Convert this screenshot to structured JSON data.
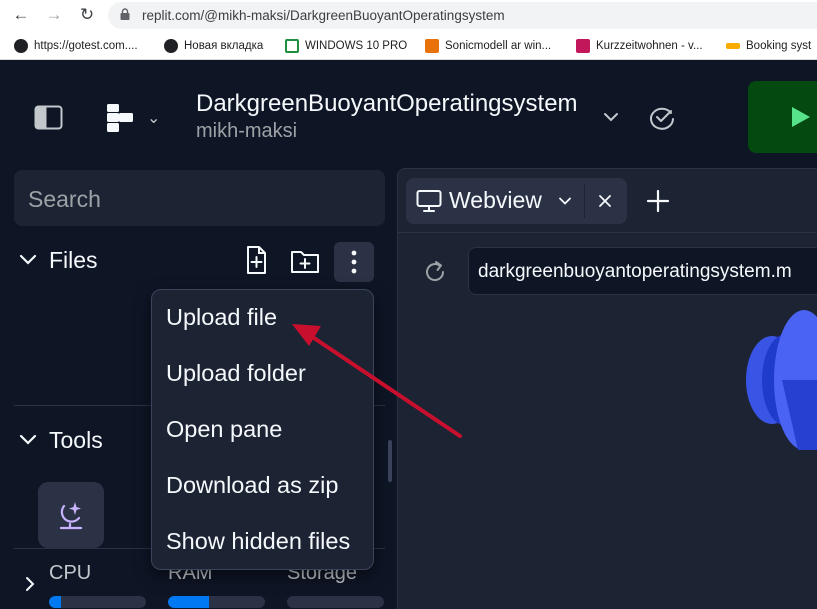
{
  "browser": {
    "url": "replit.com/@mikh-maksi/DarkgreenBuoyantOperatingsystem",
    "bookmarks": [
      {
        "label": "https://gotest.com....",
        "icon": "globe-icon"
      },
      {
        "label": "Новая вкладка",
        "icon": "globe-icon"
      },
      {
        "label": "WINDOWS 10 PRO",
        "icon": "windows-bookmark-icon"
      },
      {
        "label": "Sonicmodell ar win...",
        "icon": "bg-bookmark-icon"
      },
      {
        "label": "Kurzzeitwohnen - v...",
        "icon": "kurzzeit-bookmark-icon"
      },
      {
        "label": "Booking syst",
        "icon": "booking-bookmark-icon"
      }
    ]
  },
  "repl": {
    "title": "DarkgreenBuoyantOperatingsystem",
    "owner": "mikh-maksi"
  },
  "sidebar": {
    "search_placeholder": "Search",
    "files_label": "Files",
    "tools_label": "Tools",
    "resources": [
      {
        "label": "CPU",
        "usage": 0.12
      },
      {
        "label": "RAM",
        "usage": 0.42
      },
      {
        "label": "Storage",
        "usage": 0.0
      }
    ]
  },
  "menu": {
    "items": [
      "Upload file",
      "Upload folder",
      "Open pane",
      "Download as zip",
      "Show hidden files"
    ]
  },
  "pane": {
    "tab_label": "Webview",
    "webview_url": "darkgreenbuoyantoperatingsystem.m"
  },
  "colors": {
    "background": "#0e1525",
    "surface": "#1c2333",
    "accent_blue": "#0079f2",
    "run_green": "#044a10",
    "annotation_red": "#c8102e"
  }
}
